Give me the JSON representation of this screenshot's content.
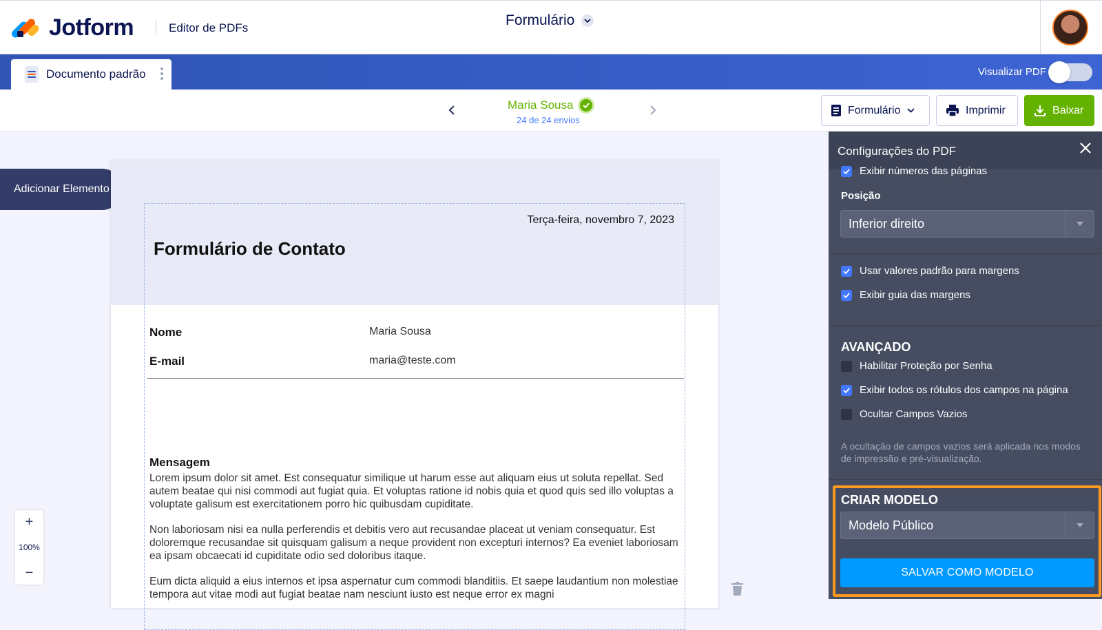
{
  "header": {
    "brand": "Jotform",
    "editor_label": "Editor de PDFs",
    "form_title": "Formulário"
  },
  "tabbar": {
    "document_tab": "Documento padrão",
    "preview_label": "Visualizar PDF",
    "preview_enabled": false
  },
  "toolbar": {
    "submitter_name": "Maria Sousa",
    "submission_count": "24 de 24 envios",
    "form_button": "Formulário",
    "print_button": "Imprimir",
    "download_button": "Baixar"
  },
  "canvas": {
    "add_element": "Adicionar Elemento",
    "zoom_level": "100%",
    "zoom_in": "+",
    "zoom_out": "−"
  },
  "document": {
    "date": "Terça-feira, novembro 7, 2023",
    "title": "Formulário de Contato",
    "fields": [
      {
        "label": "Nome",
        "value": "Maria Sousa"
      },
      {
        "label": "E-mail",
        "value": "maria@teste.com"
      }
    ],
    "message_label": "Mensagem",
    "paragraphs": [
      "Lorem ipsum dolor sit amet. Est consequatur similique ut harum esse aut aliquam eius ut soluta repellat. Sed autem beatae qui nisi commodi aut fugiat quia. Et voluptas ratione id nobis quia et quod quis sed illo voluptas a voluptate galisum est exercitationem porro hic quibusdam cupiditate.",
      "Non laboriosam nisi ea nulla perferendis et debitis vero aut recusandae placeat ut veniam consequatur. Est doloremque recusandae sit quisquam galisum a neque provident non excepturi internos? Ea eveniet laboriosam ea ipsam obcaecati id cupiditate odio sed doloribus itaque.",
      "Eum dicta aliquid a eius internos et ipsa aspernatur cum commodi blanditiis. Et saepe laudantium non molestiae tempora aut vitae modi aut fugiat beatae nam nesciunt iusto est neque error ex magni"
    ]
  },
  "panel": {
    "title": "Configurações do PDF",
    "show_page_numbers": {
      "label": "Exibir números das páginas",
      "checked": true
    },
    "position_label": "Posição",
    "position_value": "Inferior direito",
    "default_margins": {
      "label": "Usar valores padrão para margens",
      "checked": true
    },
    "margin_guide": {
      "label": "Exibir guia das margens",
      "checked": true
    },
    "advanced_heading": "AVANÇADO",
    "password_protection": {
      "label": "Habilitar Proteção por Senha",
      "checked": false
    },
    "show_all_labels": {
      "label": "Exibir todos os rótulos dos campos na página",
      "checked": true
    },
    "hide_empty": {
      "label": "Ocultar Campos Vazios",
      "checked": false
    },
    "hide_empty_note": "A ocultação de campos vazios será aplicada nos modos de impressão e pré-visualização.",
    "template_heading": "CRIAR MODELO",
    "template_value": "Modelo Público",
    "save_template_button": "SALVAR COMO MODELO"
  },
  "colors": {
    "brand_blue": "#2f54b4",
    "success_green": "#64b200",
    "primary_button": "#0099ff",
    "highlight_orange": "#ff9a1f",
    "panel_bg": "#464d61"
  },
  "icons": [
    "jotform-logo-icon",
    "chevron-down-icon",
    "document-icon",
    "kebab-icon",
    "chevron-left-icon",
    "chevron-right-icon",
    "check-badge-icon",
    "form-icon",
    "printer-icon",
    "download-icon",
    "close-icon",
    "check-icon",
    "caret-down-icon",
    "trash-icon"
  ]
}
